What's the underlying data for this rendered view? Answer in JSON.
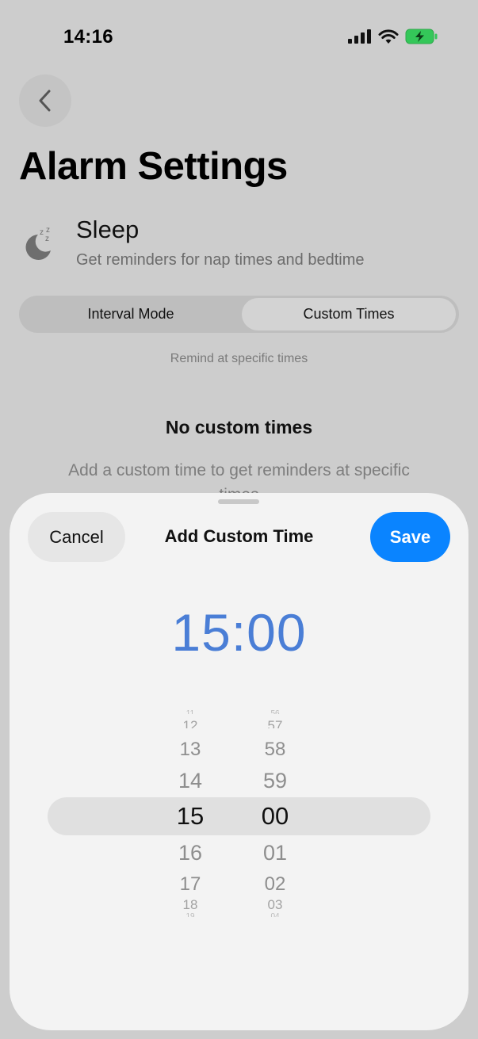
{
  "status_bar": {
    "time": "14:16"
  },
  "header": {
    "title": "Alarm Settings"
  },
  "sleep": {
    "title": "Sleep",
    "subtitle": "Get reminders for nap times and bedtime"
  },
  "mode": {
    "options": [
      "Interval Mode",
      "Custom Times"
    ],
    "selected": "Custom Times",
    "caption": "Remind at specific times"
  },
  "empty_state": {
    "title": "No custom times",
    "subtitle": "Add a custom time to get reminders at specific times"
  },
  "sheet": {
    "cancel_label": "Cancel",
    "title": "Add Custom Time",
    "save_label": "Save",
    "selected_time": "15:00",
    "hours": [
      "11",
      "12",
      "13",
      "14",
      "15",
      "16",
      "17",
      "18",
      "19"
    ],
    "minutes": [
      "56",
      "57",
      "58",
      "59",
      "00",
      "01",
      "02",
      "03",
      "04"
    ],
    "selected_hour": "15",
    "selected_minute": "00"
  },
  "colors": {
    "accent": "#0a84ff",
    "time_display": "#4a7ed6",
    "battery": "#34c759"
  }
}
